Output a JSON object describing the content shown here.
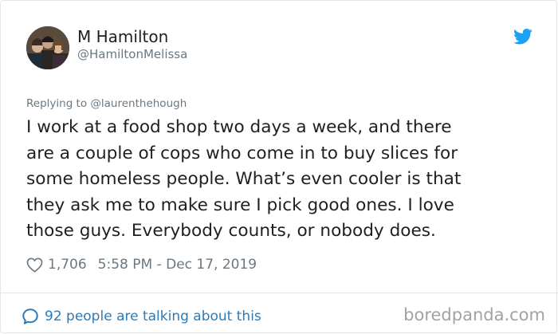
{
  "tweet": {
    "author_name": "M Hamilton",
    "author_handle": "@HamiltonMelissa",
    "replying_to": "Replying to @laurenthehough",
    "text": "I work at a food shop two days a week, and there\nare a couple of cops who come in to buy slices for\nsome homeless people. What’s even cooler is that\nthey ask me to make sure I pick good ones. I love\nthose guys. Everybody counts, or nobody does.",
    "likes": "1,706",
    "timestamp": "5:58 PM - Dec 17, 2019",
    "talking": "92 people are talking about this"
  },
  "watermark": "boredpanda.com",
  "icons": {
    "platform": "twitter-bird-icon",
    "like": "heart-icon",
    "conversation": "speech-bubble-icon"
  },
  "colors": {
    "brand": "#1da1f2",
    "link": "#2b7bb9",
    "secondary": "#697882",
    "text": "#1c2022",
    "border": "#e1e8ed"
  }
}
